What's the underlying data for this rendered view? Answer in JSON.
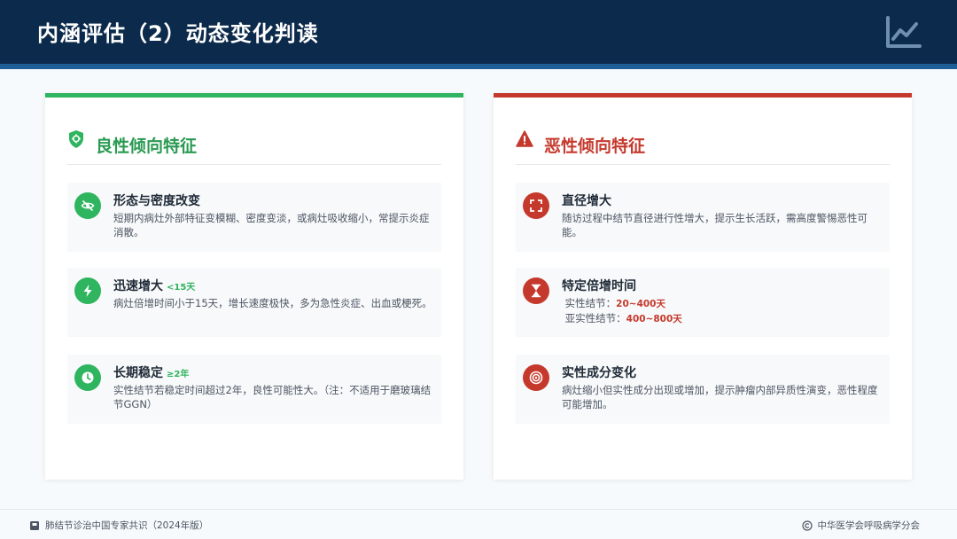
{
  "header": {
    "title": "内涵评估（2）动态变化判读",
    "icon": "line-chart-icon"
  },
  "colors": {
    "header_bg": "#0c2a4b",
    "header_border": "#1e5f98",
    "benign": "#2fb45f",
    "malignant": "#c5392d"
  },
  "benign": {
    "title": "良性倾向特征",
    "icon": "shield-icon",
    "items": [
      {
        "title": "形态与密度改变",
        "tag": "",
        "icon": "eye-off-icon",
        "desc": "短期内病灶外部特征变模糊、密度变淡，或病灶吸收缩小，常提示炎症消散。"
      },
      {
        "title": "迅速增大",
        "tag": "<15天",
        "icon": "lightning-icon",
        "desc": "病灶倍增时间小于15天，增长速度极快，多为急性炎症、出血或梗死。"
      },
      {
        "title": "长期稳定",
        "tag": "≥2年",
        "icon": "clock-icon",
        "desc": "实性结节若稳定时间超过2年，良性可能性大。（注：不适用于磨玻璃结节GGN）"
      }
    ]
  },
  "malignant": {
    "title": "恶性倾向特征",
    "icon": "warning-icon",
    "items": [
      {
        "title": "直径增大",
        "icon": "expand-icon",
        "desc": "随访过程中结节直径进行性增大，提示生长活跃，需高度警惕恶性可能。"
      },
      {
        "title": "特定倍增时间",
        "icon": "hourglass-icon",
        "lines": [
          {
            "label": "实性结节：",
            "value": "20~400天"
          },
          {
            "label": "亚实性结节：",
            "value": "400~800天"
          }
        ]
      },
      {
        "title": "实性成分变化",
        "icon": "target-icon",
        "desc": "病灶缩小但实性成分出现或增加，提示肿瘤内部异质性演变，恶性程度可能增加。"
      }
    ]
  },
  "footer": {
    "left": "肺结节诊治中国专家共识（2024年版）",
    "left_icon": "book-icon",
    "right": "中华医学会呼吸病学分会",
    "right_icon": "copyright-icon"
  }
}
